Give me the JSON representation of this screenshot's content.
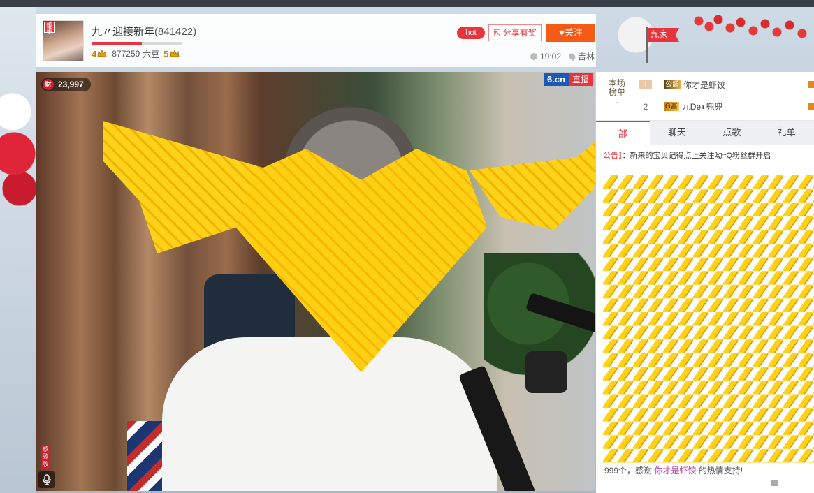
{
  "header": {
    "avatar_badge": "歌歌",
    "room_name": "九〃迎接新年",
    "room_id": "(841422)",
    "progress_fraction": 0.55,
    "level_left": "4",
    "fans_count": "877259",
    "currency_label": "六豆",
    "level_right": "5",
    "hot_label": "hot",
    "share_label": "分享有奖",
    "follow_label": "关注",
    "time": "19:02",
    "location": "吉林"
  },
  "family_flag": "九家",
  "video": {
    "wealth_icon": "财",
    "wealth_value": "23,997",
    "brand_logo": "6.cn",
    "live_label": "直播",
    "side_tag": "歌歌歌",
    "mic_icon": "microphone-icon"
  },
  "rank": {
    "label_line1": "本场",
    "label_line2": "榜单",
    "items": [
      {
        "pos": "1",
        "badge": "公爵",
        "name": "你才是虾饺"
      },
      {
        "pos": "2",
        "badge": "G富",
        "name": "九De◗兜兜"
      }
    ]
  },
  "tabs": [
    {
      "label": "部",
      "active": true
    },
    {
      "label": "聊天",
      "active": false
    },
    {
      "label": "点歌",
      "active": false
    },
    {
      "label": "礼单",
      "active": false
    }
  ],
  "notice": {
    "tag": "公告】",
    "text": "：新来的宝贝记得点上关注呦≈Q粉丝群开启"
  },
  "gift_message": {
    "prefix": "999个，感谢",
    "user": "你才是虾饺",
    "suffix": "的热情支持!"
  },
  "colors": {
    "brand_red": "#e8343d",
    "follow_orange": "#f45b16",
    "logo_blue": "#1c58b5"
  }
}
